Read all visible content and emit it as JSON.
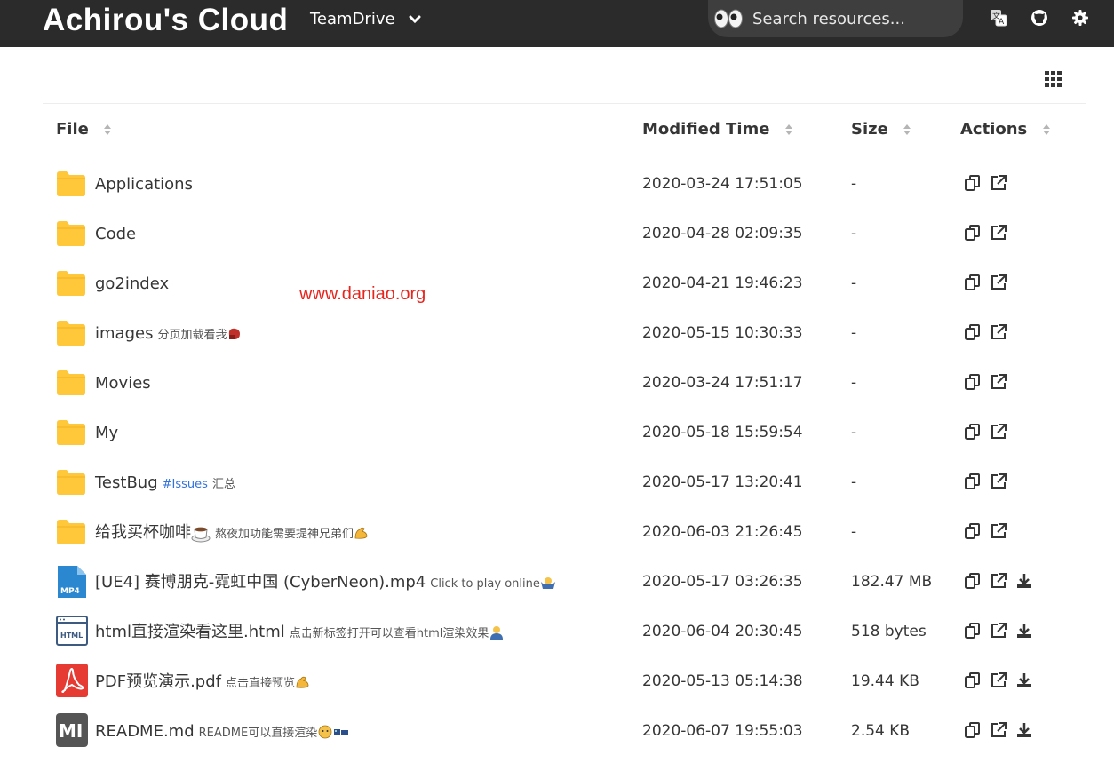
{
  "navbar": {
    "brand": "Achirou's Cloud",
    "drive": "TeamDrive",
    "search_placeholder": "Search resources...",
    "icons": [
      "translate-icon",
      "github-icon",
      "gear-icon"
    ]
  },
  "table": {
    "headers": [
      "File",
      "Modified Time",
      "Size",
      "Actions"
    ]
  },
  "watermark": "www.daniao.org",
  "files": [
    {
      "name": "Applications",
      "note": "",
      "time": "2020-03-24 17:51:05",
      "size": "-",
      "type": "folder"
    },
    {
      "name": "Code",
      "note": "",
      "time": "2020-04-28 02:09:35",
      "size": "-",
      "type": "folder"
    },
    {
      "name": "go2index",
      "note": "",
      "time": "2020-04-21 19:46:23",
      "size": "-",
      "type": "folder"
    },
    {
      "name": "images",
      "note": "分页加载看我",
      "time": "2020-05-15 10:30:33",
      "size": "-",
      "type": "folder"
    },
    {
      "name": "Movies",
      "note": "",
      "time": "2020-03-24 17:51:17",
      "size": "-",
      "type": "folder"
    },
    {
      "name": "My",
      "note": "",
      "time": "2020-05-18 15:59:54",
      "size": "-",
      "type": "folder"
    },
    {
      "name": "TestBug",
      "tag": "#Issues",
      "note": "汇总",
      "time": "2020-05-17 13:20:41",
      "size": "-",
      "type": "folder"
    },
    {
      "name": "给我买杯咖啡",
      "note": "熬夜加功能需要提神兄弟们",
      "time": "2020-06-03 21:26:45",
      "size": "-",
      "type": "folder"
    },
    {
      "name": "[UE4] 赛博朋克-霓虹中国 (CyberNeon).mp4",
      "note": "Click to play online",
      "time": "2020-05-17 03:26:35",
      "size": "182.47 MB",
      "type": "mp4"
    },
    {
      "name": "html直接渲染看这里.html",
      "note": "点击新标签打开可以查看html渲染效果",
      "time": "2020-06-04 20:30:45",
      "size": "518 bytes",
      "type": "html"
    },
    {
      "name": "PDF预览演示.pdf",
      "note": "点击直接预览",
      "time": "2020-05-13 05:14:38",
      "size": "19.44 KB",
      "type": "pdf"
    },
    {
      "name": "README.md",
      "note": "README可以直接渲染",
      "time": "2020-06-07 19:55:03",
      "size": "2.54 KB",
      "type": "md"
    }
  ],
  "file_icon_labels": {
    "mp4": "MP4",
    "html": "HTML",
    "md": "MI"
  },
  "colors": {
    "navbar": "#2b2b2b",
    "folder": "#ffc73a",
    "link": "#3273dc",
    "watermark": "#e8251d",
    "pdf": "#e53b33",
    "mp4": "#2a87d0"
  }
}
